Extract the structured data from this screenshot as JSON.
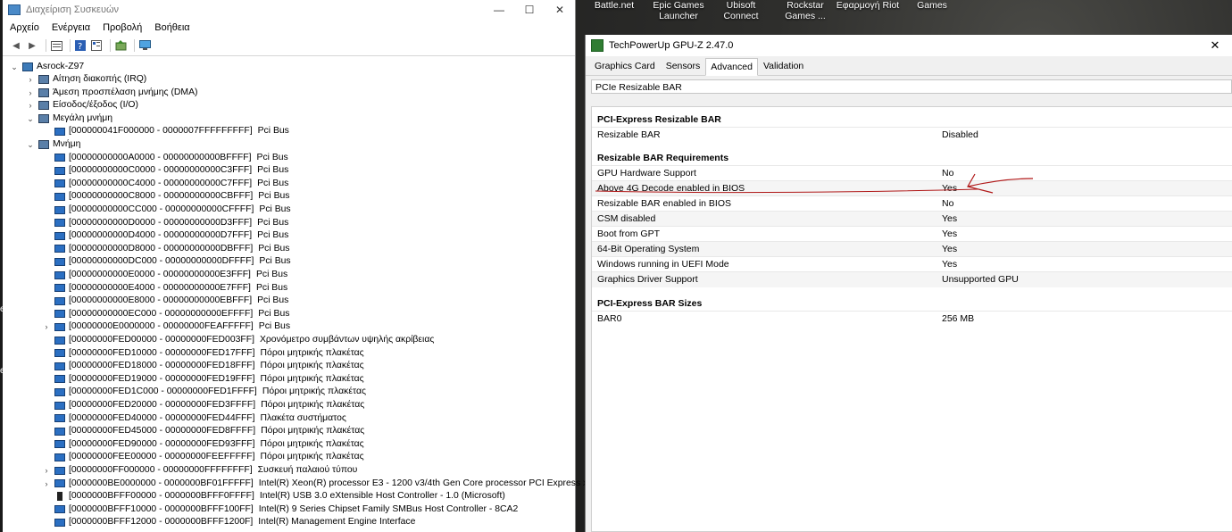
{
  "desktop": {
    "icons": [
      {
        "label": "Battle.net"
      },
      {
        "label": "Epic Games\nLauncher"
      },
      {
        "label": "Ubisoft\nConnect"
      },
      {
        "label": "Rockstar\nGames ..."
      },
      {
        "label": "Εφαρμογή Riot"
      },
      {
        "label": "Games"
      }
    ],
    "left_edge_text": [
      "er",
      "er"
    ]
  },
  "device_manager": {
    "title": "Διαχείριση Συσκευών",
    "window_controls": {
      "minimize": "—",
      "maximize": "☐",
      "close": "✕"
    },
    "menu": [
      "Αρχείο",
      "Ενέργεια",
      "Προβολή",
      "Βοήθεια"
    ],
    "root": "Asrock-Z97",
    "categories": [
      "Αίτηση διακοπής (IRQ)",
      "Άμεση προσπέλαση μνήμης (DMA)",
      "Είσοδος/έξοδος (I/O)",
      "Μεγάλη μνήμη",
      "Μνήμη"
    ],
    "large_memory_child": {
      "range": "[000000041F000000 - 0000007FFFFFFFFF]",
      "name": "Pci Bus"
    },
    "memory_children": [
      {
        "range": "[00000000000A0000 - 00000000000BFFFF]",
        "name": "Pci Bus"
      },
      {
        "range": "[00000000000C0000 - 00000000000C3FFF]",
        "name": "Pci Bus"
      },
      {
        "range": "[00000000000C4000 - 00000000000C7FFF]",
        "name": "Pci Bus"
      },
      {
        "range": "[00000000000C8000 - 00000000000CBFFF]",
        "name": "Pci Bus"
      },
      {
        "range": "[00000000000CC000 - 00000000000CFFFF]",
        "name": "Pci Bus"
      },
      {
        "range": "[00000000000D0000 - 00000000000D3FFF]",
        "name": "Pci Bus"
      },
      {
        "range": "[00000000000D4000 - 00000000000D7FFF]",
        "name": "Pci Bus"
      },
      {
        "range": "[00000000000D8000 - 00000000000DBFFF]",
        "name": "Pci Bus"
      },
      {
        "range": "[00000000000DC000 - 00000000000DFFFF]",
        "name": "Pci Bus"
      },
      {
        "range": "[00000000000E0000 - 00000000000E3FFF]",
        "name": "Pci Bus"
      },
      {
        "range": "[00000000000E4000 - 00000000000E7FFF]",
        "name": "Pci Bus"
      },
      {
        "range": "[00000000000E8000 - 00000000000EBFFF]",
        "name": "Pci Bus"
      },
      {
        "range": "[00000000000EC000 - 00000000000EFFFF]",
        "name": "Pci Bus"
      },
      {
        "range": "[00000000E0000000 - 00000000FEAFFFFF]",
        "name": "Pci Bus",
        "expandable": true
      },
      {
        "range": "[00000000FED00000 - 00000000FED003FF]",
        "name": "Χρονόμετρο συμβάντων υψηλής ακρίβειας"
      },
      {
        "range": "[00000000FED10000 - 00000000FED17FFF]",
        "name": "Πόροι μητρικής πλακέτας"
      },
      {
        "range": "[00000000FED18000 - 00000000FED18FFF]",
        "name": "Πόροι μητρικής πλακέτας"
      },
      {
        "range": "[00000000FED19000 - 00000000FED19FFF]",
        "name": "Πόροι μητρικής πλακέτας"
      },
      {
        "range": "[00000000FED1C000 - 00000000FED1FFFF]",
        "name": "Πόροι μητρικής πλακέτας"
      },
      {
        "range": "[00000000FED20000 - 00000000FED3FFFF]",
        "name": "Πόροι μητρικής πλακέτας"
      },
      {
        "range": "[00000000FED40000 - 00000000FED44FFF]",
        "name": "Πλακέτα συστήματος"
      },
      {
        "range": "[00000000FED45000 - 00000000FED8FFFF]",
        "name": "Πόροι μητρικής πλακέτας"
      },
      {
        "range": "[00000000FED90000 - 00000000FED93FFF]",
        "name": "Πόροι μητρικής πλακέτας"
      },
      {
        "range": "[00000000FEE00000 - 00000000FEEFFFFF]",
        "name": "Πόροι μητρικής πλακέτας"
      },
      {
        "range": "[00000000FF000000 - 00000000FFFFFFFF]",
        "name": "Συσκευή παλαιού τύπου",
        "expandable": true
      },
      {
        "range": "[0000000BE0000000 - 0000000BF01FFFFF]",
        "name": "Intel(R) Xeon(R) processor E3 - 1200 v3/4th Gen Core processor PCI Express x16 Controller - 0C01",
        "expandable": true
      },
      {
        "range": "[0000000BFFF00000 - 0000000BFFF0FFFF]",
        "name": "Intel(R) USB 3.0 eXtensible Host Controller - 1.0 (Microsoft)",
        "icon": "usb"
      },
      {
        "range": "[0000000BFFF10000 - 0000000BFFF100FF]",
        "name": "Intel(R) 9 Series Chipset Family SMBus Host Controller - 8CA2"
      },
      {
        "range": "[0000000BFFF12000 - 0000000BFFF1200F]",
        "name": "Intel(R) Management Engine Interface"
      }
    ]
  },
  "gpuz": {
    "title": "TechPowerUp GPU-Z 2.47.0",
    "close": "✕",
    "tabs": [
      "Graphics Card",
      "Sensors",
      "Advanced",
      "Validation"
    ],
    "active_tab": "Advanced",
    "selected_section": "PCIe Resizable BAR",
    "sections": [
      {
        "heading": "PCI-Express Resizable BAR",
        "rows": [
          [
            "Resizable BAR",
            "Disabled"
          ]
        ]
      },
      {
        "heading": "Resizable BAR Requirements",
        "rows": [
          [
            "GPU Hardware Support",
            "No"
          ],
          [
            "Above 4G Decode enabled in BIOS",
            "Yes"
          ],
          [
            "Resizable BAR enabled in BIOS",
            "No"
          ],
          [
            "CSM disabled",
            "Yes"
          ],
          [
            "Boot from GPT",
            "Yes"
          ],
          [
            "64-Bit Operating System",
            "Yes"
          ],
          [
            "Windows running in UEFI Mode",
            "Yes"
          ],
          [
            "Graphics Driver Support",
            "Unsupported GPU"
          ]
        ]
      },
      {
        "heading": "PCI-Express BAR Sizes",
        "rows": [
          [
            "BAR0",
            "256 MB"
          ]
        ]
      }
    ],
    "annotation_color": "#b01818"
  }
}
